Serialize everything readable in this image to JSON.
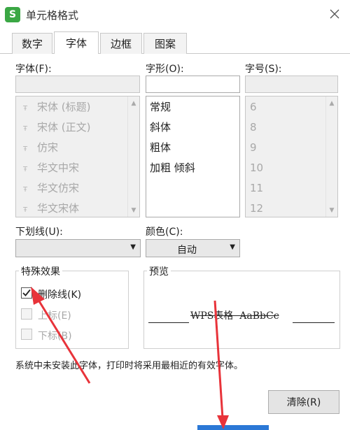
{
  "window": {
    "app_icon": "S",
    "title": "单元格格式",
    "close_icon": "close-icon"
  },
  "tabs": [
    {
      "label": "数字",
      "active": false
    },
    {
      "label": "字体",
      "active": true
    },
    {
      "label": "边框",
      "active": false
    },
    {
      "label": "图案",
      "active": false
    }
  ],
  "font": {
    "label": "字体(F):",
    "value": "",
    "items": [
      "宋体 (标题)",
      "宋体 (正文)",
      "仿宋",
      "华文中宋",
      "华文仿宋",
      "华文宋体"
    ],
    "item_glyph": "Ŧ"
  },
  "style": {
    "label": "字形(O):",
    "value": "",
    "items": [
      "常规",
      "斜体",
      "粗体",
      "加粗 倾斜"
    ]
  },
  "size": {
    "label": "字号(S):",
    "value": "",
    "items": [
      "6",
      "8",
      "9",
      "10",
      "11",
      "12"
    ]
  },
  "underline": {
    "label": "下划线(U):",
    "value": ""
  },
  "color": {
    "label": "颜色(C):",
    "value": "自动"
  },
  "effects": {
    "title": "特殊效果",
    "strikethrough": {
      "label": "删除线(K)",
      "checked": true
    },
    "superscript": {
      "label": "上标(E)",
      "checked": false
    },
    "subscript": {
      "label": "下标(B)",
      "checked": false
    }
  },
  "preview": {
    "title": "预览",
    "sample": "WPS表格  AaBbCc"
  },
  "note": "系统中未安装此字体，打印时将采用最相近的有效字体。",
  "buttons": {
    "clear": "清除(R)"
  },
  "colors": {
    "accent_green": "#3aa744",
    "annotation_red": "#e8333a",
    "ok_blue": "#2b78d6"
  }
}
